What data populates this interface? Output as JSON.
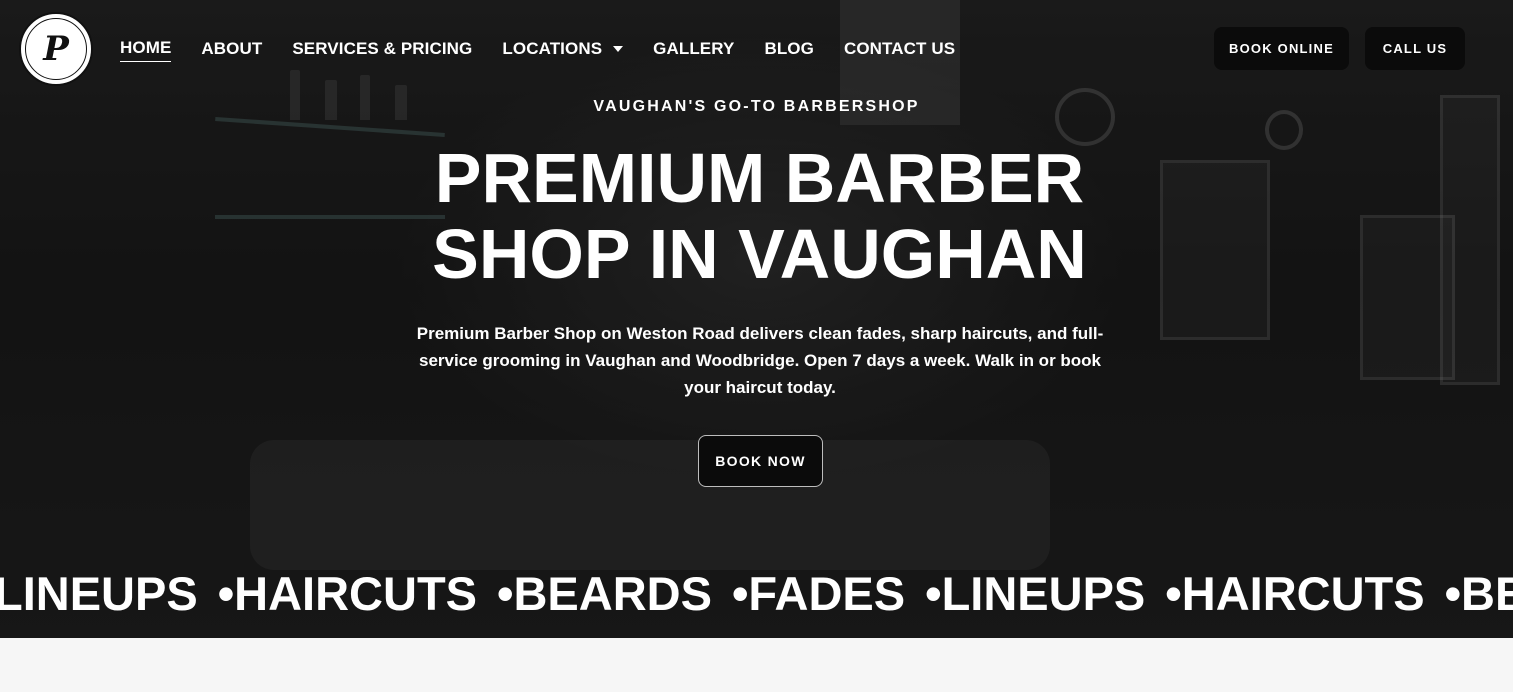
{
  "logo": {
    "mark": "P",
    "alt_text": "PREMIUM BARBER SHOP INC"
  },
  "nav": {
    "items": [
      {
        "label": "HOME",
        "active": true
      },
      {
        "label": "ABOUT"
      },
      {
        "label": "SERVICES & PRICING"
      },
      {
        "label": "LOCATIONS",
        "has_dropdown": true
      },
      {
        "label": "GALLERY"
      },
      {
        "label": "BLOG"
      },
      {
        "label": "CONTACT US"
      }
    ],
    "book_online": "BOOK ONLINE",
    "call_us": "CALL US"
  },
  "hero": {
    "eyebrow": "VAUGHAN'S GO-TO BARBERSHOP",
    "headline_line1": "PREMIUM BARBER",
    "headline_line2": "SHOP IN VAUGHAN",
    "description": "Premium Barber Shop on Weston Road delivers clean fades, sharp haircuts, and full-service grooming in Vaughan and Woodbridge. Open 7 days a week. Walk in or book your haircut today.",
    "cta": "BOOK NOW"
  },
  "marquee": {
    "items": [
      "LINEUPS",
      "HAIRCUTS",
      "BEARDS",
      "FADES",
      "LINEUPS",
      "HAIRCUTS",
      "BEA"
    ],
    "separator": "•"
  },
  "colors": {
    "button_bg": "#0b0b0b",
    "text": "#ffffff",
    "page_bg": "#f6f6f6"
  }
}
